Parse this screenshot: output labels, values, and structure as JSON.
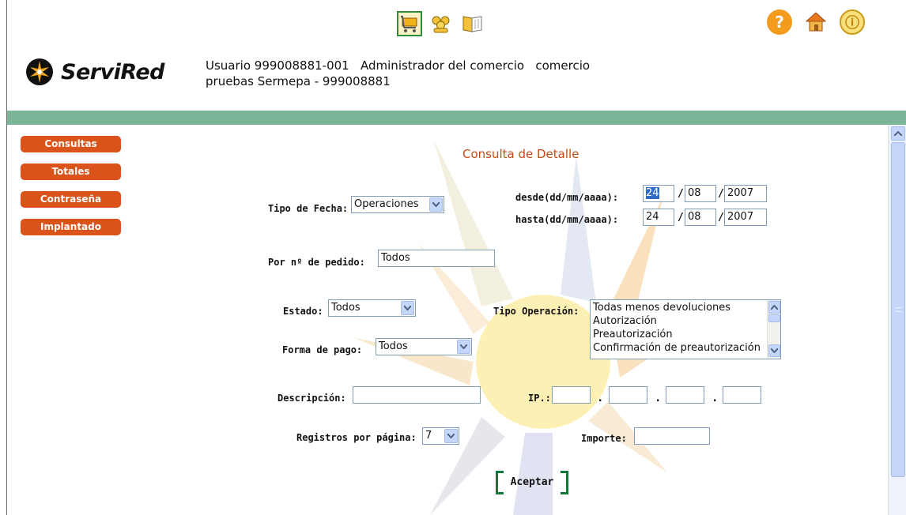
{
  "header": {
    "top_icons": [
      "cart-icon",
      "users-icon",
      "book-icon"
    ],
    "right_icons": [
      "help-icon",
      "home-icon",
      "power-icon"
    ],
    "help_glyph": "?",
    "power_glyph": "ⓘ",
    "logo_text": "ServiRed",
    "user_line1": "Usuario 999008881-001   Administrador del comercio   comercio",
    "user_line2": "pruebas Sermepa - 999008881"
  },
  "sidebar": {
    "items": [
      {
        "label": "Consultas"
      },
      {
        "label": "Totales"
      },
      {
        "label": "Contraseña"
      },
      {
        "label": "Implantado"
      }
    ]
  },
  "form": {
    "title": "Consulta de Detalle",
    "tipo_fecha_label": "Tipo de Fecha:",
    "tipo_fecha_value": "Operaciones",
    "desde_label": "desde(dd/mm/aaaa):",
    "desde_day": "24",
    "desde_month": "08",
    "desde_year": "2007",
    "hasta_label": "hasta(dd/mm/aaaa):",
    "hasta_day": "24",
    "hasta_month": "08",
    "hasta_year": "2007",
    "slash": "/",
    "pedido_label": "Por nº de pedido:",
    "pedido_value": "Todos",
    "estado_label": "Estado:",
    "estado_value": "Todos",
    "tipo_operacion_label": "Tipo Operación:",
    "tipo_operacion_options": [
      "Todas menos devoluciones",
      "Autorización",
      "Preautorización",
      "Confirmación de preautorización"
    ],
    "forma_pago_label": "Forma de pago:",
    "forma_pago_value": "Todos",
    "descripcion_label": "Descripción:",
    "descripcion_value": "",
    "ip_label": "IP.:",
    "ip_dot": ".",
    "registros_label": "Registros por página:",
    "registros_value": "7",
    "importe_label": "Importe:",
    "importe_value": "",
    "aceptar_label": "Aceptar"
  },
  "colors": {
    "menu_button": "#d9531a",
    "title": "#c24b17",
    "green_bar": "#7bb497",
    "accept_border": "#0e7a3a"
  }
}
